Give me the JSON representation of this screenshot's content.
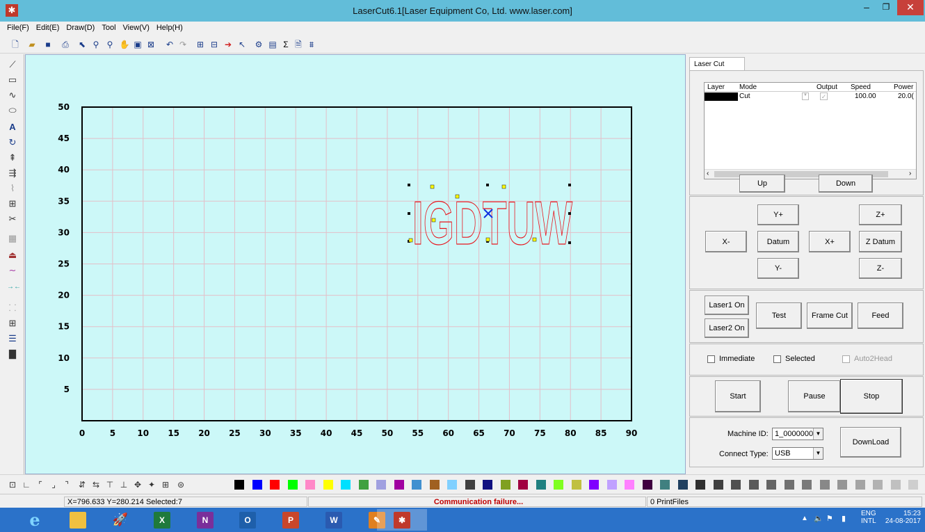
{
  "window": {
    "title": "LaserCut6.1[Laser Equipment Co, Ltd. www.laser.com]"
  },
  "menu": [
    "File(F)",
    "Edit(E)",
    "Draw(D)",
    "Tool",
    "View(V)",
    "Help(H)"
  ],
  "toolbar_icons": [
    "new-file-icon",
    "open-file-icon",
    "save-icon",
    "import-icon",
    "select-icon",
    "zoom-in-icon",
    "zoom-out-icon",
    "pan-icon",
    "zoom-page-icon",
    "zoom-fit-icon",
    "undo-icon",
    "redo-icon",
    "array-icon",
    "group-icon",
    "path-icon",
    "node-icon",
    "properties-icon",
    "layer-icon",
    "sigma-icon",
    "preview-icon",
    "simulate-icon"
  ],
  "left_tools": [
    "line-icon",
    "rectangle-icon",
    "curve-icon",
    "ellipse-icon",
    "text-icon",
    "rotate-icon",
    "mirror-icon",
    "align-icon",
    "node-edit-icon",
    "grid-icon",
    "scissors-icon",
    "fill-icon",
    "offset-icon",
    "smooth-icon",
    "join-icon",
    "break-icon",
    "array-icon",
    "sort-icon",
    "image-icon"
  ],
  "canvas": {
    "x_ticks": [
      "0",
      "5",
      "10",
      "15",
      "20",
      "25",
      "30",
      "35",
      "40",
      "45",
      "50",
      "55",
      "60",
      "65",
      "70",
      "75",
      "80",
      "85",
      "90"
    ],
    "y_ticks": [
      "50",
      "45",
      "40",
      "35",
      "30",
      "25",
      "20",
      "15",
      "10",
      "5"
    ],
    "design_text": "IGDTUW",
    "colors": {
      "background": "#ccf8f8",
      "grid": "#e3bfc8",
      "shape": "#e8141c"
    }
  },
  "panel": {
    "tab": "Laser Cut",
    "table": {
      "headers": [
        "Layer",
        "Mode",
        "Output",
        "Speed",
        "Power"
      ],
      "row": {
        "mode": "Cut",
        "speed": "100.00",
        "power": "20.0("
      }
    },
    "buttons": {
      "up": "Up",
      "down": "Down",
      "y_plus": "Y+",
      "z_plus": "Z+",
      "x_minus": "X-",
      "datum": "Datum",
      "x_plus": "X+",
      "z_datum": "Z Datum",
      "y_minus": "Y-",
      "z_minus": "Z-",
      "laser1": "Laser1 On",
      "laser2": "Laser2 On",
      "test": "Test",
      "frame_cut": "Frame Cut",
      "feed": "Feed",
      "start": "Start",
      "pause": "Pause",
      "stop": "Stop",
      "download": "DownLoad"
    },
    "checks": {
      "immediate": "Immediate",
      "selected": "Selected",
      "auto2head": "Auto2Head"
    },
    "machine_id_label": "Machine ID:",
    "machine_id": "1_0000000",
    "connect_type_label": "Connect Type:",
    "connect_type": "USB"
  },
  "palette": [
    "#000000",
    "#0000ff",
    "#ff0000",
    "#00ff00",
    "#ff88c8",
    "#ffff00",
    "#00e0ff",
    "#40a040",
    "#a0a0e0",
    "#a000a0",
    "#4090d0",
    "#a06020",
    "#80d0ff",
    "#404040",
    "#101080",
    "#80a020",
    "#a00040",
    "#208080",
    "#80ff20",
    "#c0c040",
    "#8000ff",
    "#c0a0ff",
    "#ff80ff",
    "#400040",
    "#408080",
    "#204060",
    "#303030",
    "#404040",
    "#505050",
    "#5a5a5a",
    "#646464",
    "#707070",
    "#7a7a7a",
    "#888888",
    "#969696",
    "#a4a4a4",
    "#b2b2b2",
    "#c0c0c0",
    "#cecece",
    "#dcdcdc",
    "#e8e8e8"
  ],
  "status": {
    "coords": "X=796.633 Y=280.214 Selected:7",
    "message": "Communication failure...",
    "files": "0 PrintFiles"
  },
  "taskbar": {
    "apps": [
      "internet-explorer-icon",
      "file-explorer-icon",
      "rocket-app-icon",
      "excel-icon",
      "onenote-icon",
      "outlook-icon",
      "powerpoint-icon",
      "word-icon",
      "paint-app-icon",
      "lasercut-icon"
    ],
    "lang": "ENG",
    "lang2": "INTL",
    "time": "15:23",
    "date": "24-08-2017"
  }
}
